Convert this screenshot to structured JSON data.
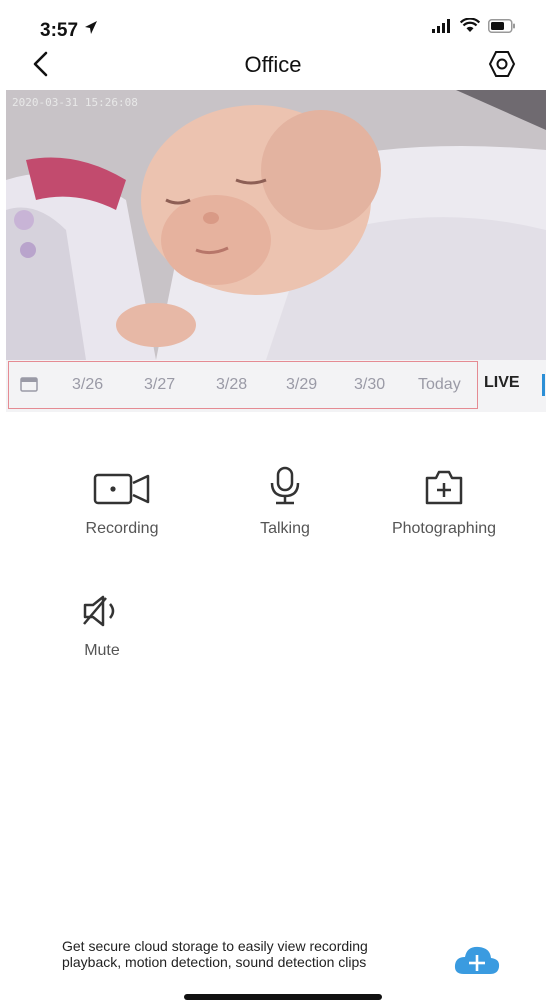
{
  "status_bar": {
    "time": "3:57"
  },
  "nav": {
    "title": "Office"
  },
  "video": {
    "timestamp": "2020-03-31 15:26:08"
  },
  "dates": [
    {
      "label": "3/26"
    },
    {
      "label": "3/27"
    },
    {
      "label": "3/28"
    },
    {
      "label": "3/29"
    },
    {
      "label": "3/30"
    },
    {
      "label": "Today"
    }
  ],
  "live_label": "LIVE",
  "actions": {
    "recording": "Recording",
    "talking": "Talking",
    "photographing": "Photographing",
    "mute": "Mute"
  },
  "promo": {
    "text": "Get secure cloud storage to easily view recording playback, motion detection, sound detection clips"
  },
  "colors": {
    "accent": "#2c8fd6",
    "cloud": "#3a9be0",
    "highlight_border": "#e58b93"
  }
}
